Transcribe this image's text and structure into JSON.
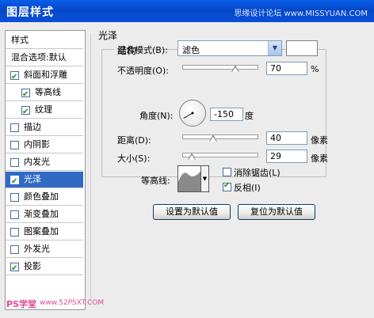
{
  "window": {
    "title": "图层样式",
    "watermark": "思缘设计论坛 www.MISSYUAN.COM"
  },
  "left_panel": {
    "items": [
      {
        "label": "样式",
        "checkbox": false,
        "checked": false,
        "selected": false,
        "indent": 0
      },
      {
        "label": "混合选项:默认",
        "checkbox": false,
        "checked": false,
        "selected": false,
        "indent": 0
      },
      {
        "label": "斜面和浮雕",
        "checkbox": true,
        "checked": true,
        "selected": false,
        "indent": 0
      },
      {
        "label": "等高线",
        "checkbox": true,
        "checked": true,
        "selected": false,
        "indent": 1
      },
      {
        "label": "纹理",
        "checkbox": true,
        "checked": true,
        "selected": false,
        "indent": 1
      },
      {
        "label": "描边",
        "checkbox": true,
        "checked": false,
        "selected": false,
        "indent": 0
      },
      {
        "label": "内阴影",
        "checkbox": true,
        "checked": false,
        "selected": false,
        "indent": 0
      },
      {
        "label": "内发光",
        "checkbox": true,
        "checked": false,
        "selected": false,
        "indent": 0
      },
      {
        "label": "光泽",
        "checkbox": true,
        "checked": true,
        "selected": true,
        "indent": 0
      },
      {
        "label": "颜色叠加",
        "checkbox": true,
        "checked": false,
        "selected": false,
        "indent": 0
      },
      {
        "label": "渐变叠加",
        "checkbox": true,
        "checked": false,
        "selected": false,
        "indent": 0
      },
      {
        "label": "图案叠加",
        "checkbox": true,
        "checked": false,
        "selected": false,
        "indent": 0
      },
      {
        "label": "外发光",
        "checkbox": true,
        "checked": false,
        "selected": false,
        "indent": 0
      },
      {
        "label": "投影",
        "checkbox": true,
        "checked": true,
        "selected": false,
        "indent": 0
      }
    ]
  },
  "satin": {
    "group_title": "光泽",
    "structure_title": "结构",
    "blend_mode": {
      "label": "混合模式(B):",
      "value": "滤色",
      "color": "#ffffff"
    },
    "opacity": {
      "label": "不透明度(O):",
      "value": "70",
      "unit": "%",
      "fraction": 0.7
    },
    "angle": {
      "label": "角度(N):",
      "value": "-150",
      "unit": "度",
      "degrees": -150
    },
    "distance": {
      "label": "距离(D):",
      "value": "40",
      "unit": "像素",
      "fraction": 0.4
    },
    "size": {
      "label": "大小(S):",
      "value": "29",
      "unit": "像素",
      "fraction": 0.12
    },
    "contour": {
      "label": "等高线:"
    },
    "anti_alias": {
      "label": "消除锯齿(L)",
      "checked": false
    },
    "invert": {
      "label": "反相(I)",
      "checked": true
    }
  },
  "buttons": {
    "make_default": "设置为默认值",
    "reset_default": "复位为默认值"
  },
  "footer": {
    "logo": "PS学堂",
    "site": "www.52PSXT.COM"
  }
}
